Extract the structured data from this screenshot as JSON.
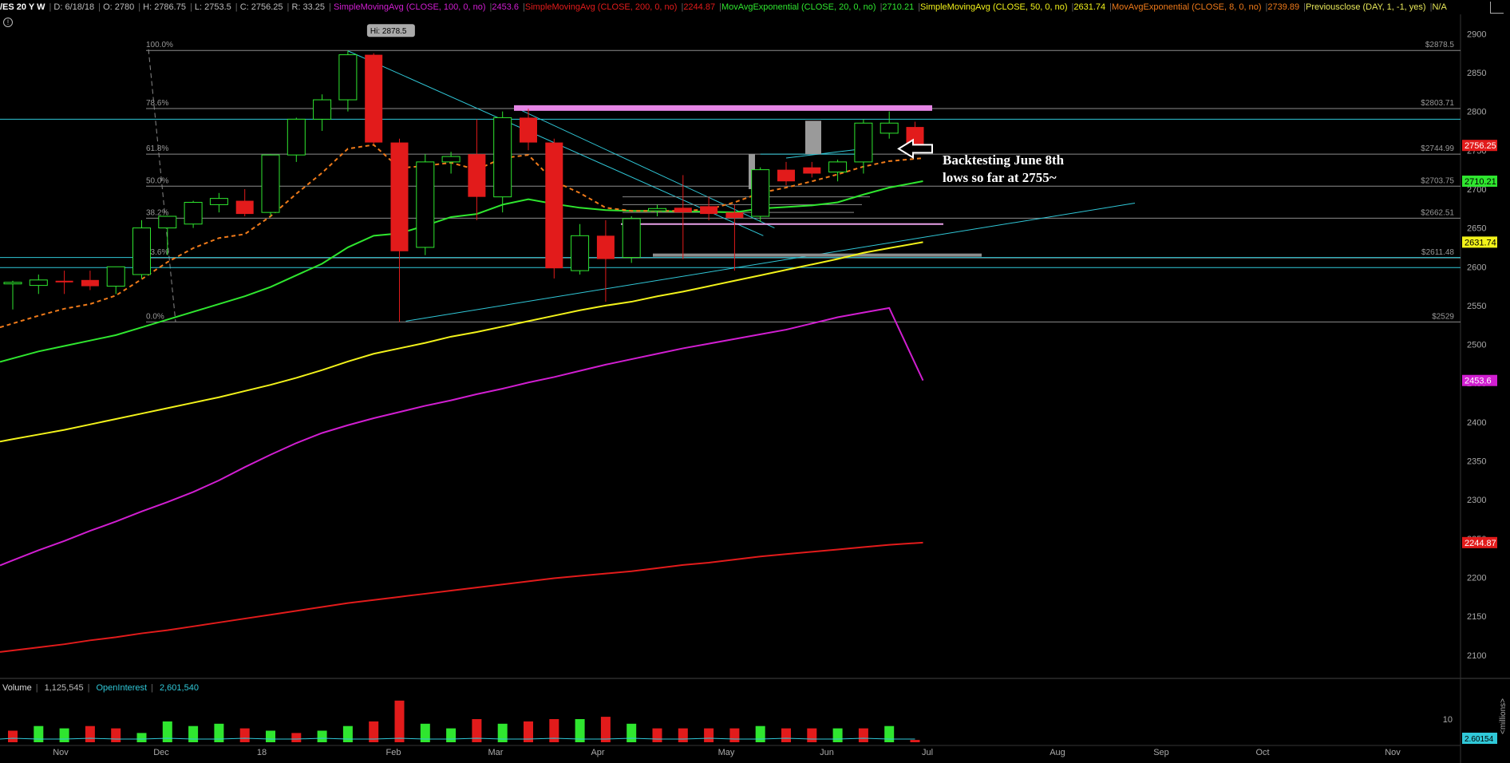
{
  "header": {
    "symbol": "/ES 20 Y W",
    "date": "D: 6/18/18",
    "open": "O: 2780",
    "high": "H: 2786.75",
    "low": "L: 2753.5",
    "close": "C: 2756.25",
    "range": "R: 33.25",
    "studies": [
      {
        "label": "SimpleMovingAvg (CLOSE, 100, 0, no)",
        "value": "2453.6",
        "color": "#d11ed1"
      },
      {
        "label": "SimpleMovingAvg (CLOSE, 200, 0, no)",
        "value": "2244.87",
        "color": "#e21b1b"
      },
      {
        "label": "MovAvgExponential (CLOSE, 20, 0, no)",
        "value": "2710.21",
        "color": "#2fe62f"
      },
      {
        "label": "SimpleMovingAvg (CLOSE, 50, 0, no)",
        "value": "2631.74",
        "color": "#f2f21a"
      },
      {
        "label": "MovAvgExponential (CLOSE, 8, 0, no)",
        "value": "2739.89",
        "color": "#ef7a1a"
      },
      {
        "label": "Previousclose (DAY, 1, -1, yes)",
        "value": "N/A",
        "color": "#e8e85a"
      }
    ]
  },
  "alert_icon": "info-circle-icon",
  "annotation": {
    "line1": "Backtesting June 8th",
    "line2": "lows so far at 2755~",
    "arrow_icon": "left-arrow-icon"
  },
  "volume_panel": {
    "label": "Volume",
    "value": "1,125,545",
    "oi_label": "OpenInterest",
    "oi_value": "2,601,540",
    "axis_tick": "10",
    "axis_unit": "<millions>",
    "oi_tag": "2.60154"
  },
  "chart_data": {
    "type": "candlestick",
    "title": "",
    "ylim": [
      2070,
      2925
    ],
    "y_ticks": [
      2100,
      2150,
      2200,
      2250,
      2300,
      2350,
      2400,
      2450,
      2500,
      2550,
      2600,
      2650,
      2700,
      2750,
      2800,
      2850,
      2900
    ],
    "x_labels": [
      "Nov",
      "Dec",
      "18",
      "Feb",
      "Mar",
      "Apr",
      "May",
      "Jun",
      "Jul",
      "Aug",
      "Sep",
      "Oct",
      "Nov"
    ],
    "candles": [
      {
        "o": 2578,
        "h": 2582,
        "l": 2545,
        "c": 2580
      },
      {
        "o": 2576,
        "h": 2590,
        "l": 2565,
        "c": 2583
      },
      {
        "o": 2582,
        "h": 2595,
        "l": 2565,
        "c": 2580
      },
      {
        "o": 2583,
        "h": 2595,
        "l": 2570,
        "c": 2575
      },
      {
        "o": 2575,
        "h": 2600,
        "l": 2565,
        "c": 2600
      },
      {
        "o": 2590,
        "h": 2660,
        "l": 2585,
        "c": 2650
      },
      {
        "o": 2650,
        "h": 2665,
        "l": 2615,
        "c": 2665
      },
      {
        "o": 2655,
        "h": 2685,
        "l": 2650,
        "c": 2683
      },
      {
        "o": 2680,
        "h": 2695,
        "l": 2670,
        "c": 2688
      },
      {
        "o": 2685,
        "h": 2700,
        "l": 2665,
        "c": 2668
      },
      {
        "o": 2670,
        "h": 2745,
        "l": 2665,
        "c": 2744
      },
      {
        "o": 2744,
        "h": 2792,
        "l": 2735,
        "c": 2790
      },
      {
        "o": 2790,
        "h": 2822,
        "l": 2775,
        "c": 2815
      },
      {
        "o": 2815,
        "h": 2878.5,
        "l": 2800,
        "c": 2873
      },
      {
        "o": 2873,
        "h": 2875,
        "l": 2758,
        "c": 2760
      },
      {
        "o": 2760,
        "h": 2765,
        "l": 2529,
        "c": 2620
      },
      {
        "o": 2625,
        "h": 2745,
        "l": 2615,
        "c": 2735
      },
      {
        "o": 2735,
        "h": 2748,
        "l": 2720,
        "c": 2742
      },
      {
        "o": 2745,
        "h": 2790,
        "l": 2660,
        "c": 2690
      },
      {
        "o": 2690,
        "h": 2800,
        "l": 2670,
        "c": 2792
      },
      {
        "o": 2792,
        "h": 2803.5,
        "l": 2750,
        "c": 2760
      },
      {
        "o": 2760,
        "h": 2765,
        "l": 2585,
        "c": 2598
      },
      {
        "o": 2595,
        "h": 2655,
        "l": 2590,
        "c": 2640
      },
      {
        "o": 2640,
        "h": 2660,
        "l": 2555,
        "c": 2610
      },
      {
        "o": 2612,
        "h": 2665,
        "l": 2605,
        "c": 2662
      },
      {
        "o": 2672,
        "h": 2680,
        "l": 2665,
        "c": 2675
      },
      {
        "o": 2676,
        "h": 2718,
        "l": 2610,
        "c": 2670
      },
      {
        "o": 2678,
        "h": 2690,
        "l": 2660,
        "c": 2668
      },
      {
        "o": 2670,
        "h": 2680,
        "l": 2595,
        "c": 2663
      },
      {
        "o": 2665,
        "h": 2728,
        "l": 2658,
        "c": 2725
      },
      {
        "o": 2725,
        "h": 2735,
        "l": 2705,
        "c": 2710
      },
      {
        "o": 2728,
        "h": 2735,
        "l": 2715,
        "c": 2720
      },
      {
        "o": 2722,
        "h": 2738,
        "l": 2710,
        "c": 2735
      },
      {
        "o": 2735,
        "h": 2790,
        "l": 2720,
        "c": 2785
      },
      {
        "o": 2772,
        "h": 2800,
        "l": 2765,
        "c": 2785
      },
      {
        "o": 2780,
        "h": 2786.75,
        "l": 2753.5,
        "c": 2756.25
      }
    ],
    "volume": [
      {
        "v": 5,
        "up": false
      },
      {
        "v": 7,
        "up": true
      },
      {
        "v": 6,
        "up": true
      },
      {
        "v": 7,
        "up": false
      },
      {
        "v": 6,
        "up": false
      },
      {
        "v": 4,
        "up": true
      },
      {
        "v": 9,
        "up": true
      },
      {
        "v": 7,
        "up": true
      },
      {
        "v": 8,
        "up": true
      },
      {
        "v": 6,
        "up": false
      },
      {
        "v": 5,
        "up": true
      },
      {
        "v": 4,
        "up": false
      },
      {
        "v": 5,
        "up": true
      },
      {
        "v": 7,
        "up": true
      },
      {
        "v": 9,
        "up": false
      },
      {
        "v": 18,
        "up": false
      },
      {
        "v": 8,
        "up": true
      },
      {
        "v": 6,
        "up": true
      },
      {
        "v": 10,
        "up": false
      },
      {
        "v": 8,
        "up": true
      },
      {
        "v": 9,
        "up": false
      },
      {
        "v": 10,
        "up": false
      },
      {
        "v": 10,
        "up": true
      },
      {
        "v": 11,
        "up": false
      },
      {
        "v": 8,
        "up": true
      },
      {
        "v": 6,
        "up": false
      },
      {
        "v": 6,
        "up": false
      },
      {
        "v": 6,
        "up": false
      },
      {
        "v": 6,
        "up": false
      },
      {
        "v": 7,
        "up": true
      },
      {
        "v": 6,
        "up": false
      },
      {
        "v": 6,
        "up": false
      },
      {
        "v": 6,
        "up": true
      },
      {
        "v": 6,
        "up": false
      },
      {
        "v": 7,
        "up": true
      },
      {
        "v": 1,
        "up": false
      }
    ],
    "moving_averages": [
      {
        "name": "SimpleMovingAvg (CLOSE, 100, 0, no)",
        "color": "#d11ed1",
        "style": "solid",
        "values": [
          2222,
          2235,
          2247,
          2260,
          2272,
          2285,
          2297,
          2310,
          2325,
          2342,
          2358,
          2373,
          2386,
          2396,
          2405,
          2413,
          2421,
          2428,
          2436,
          2443,
          2451,
          2458,
          2466,
          2474,
          2481,
          2488,
          2495,
          2501,
          2507,
          2513,
          2519,
          2527,
          2535,
          2541,
          2547,
          2453.6
        ]
      },
      {
        "name": "SimpleMovingAvg (CLOSE, 200, 0, no)",
        "color": "#e21b1b",
        "style": "solid",
        "values": [
          2106,
          2110,
          2114,
          2119,
          2123,
          2128,
          2132,
          2137,
          2142,
          2147,
          2152,
          2157,
          2162,
          2167,
          2171,
          2175,
          2179,
          2183,
          2187,
          2191,
          2195,
          2199,
          2202,
          2205,
          2208,
          2212,
          2216,
          2219,
          2223,
          2227,
          2230,
          2233,
          2236,
          2239,
          2242,
          2244.87
        ]
      },
      {
        "name": "MovAvgExponential (CLOSE, 20, 0, no)",
        "color": "#2fe62f",
        "style": "solid",
        "values": [
          2482,
          2491,
          2498,
          2505,
          2512,
          2522,
          2532,
          2542,
          2552,
          2562,
          2574,
          2589,
          2604,
          2625,
          2640,
          2643,
          2653,
          2664,
          2668,
          2680,
          2687,
          2681,
          2676,
          2673,
          2672,
          2672,
          2671,
          2671,
          2670,
          2675,
          2677,
          2679,
          2683,
          2693,
          2702,
          2710.21
        ]
      },
      {
        "name": "SimpleMovingAvg (CLOSE, 50, 0, no)",
        "color": "#f2f21a",
        "style": "solid",
        "values": [
          2378,
          2384,
          2390,
          2397,
          2404,
          2411,
          2418,
          2425,
          2432,
          2440,
          2448,
          2457,
          2467,
          2478,
          2488,
          2495,
          2502,
          2510,
          2516,
          2523,
          2530,
          2537,
          2544,
          2550,
          2555,
          2562,
          2568,
          2575,
          2582,
          2589,
          2596,
          2603,
          2610,
          2618,
          2624,
          2631.74
        ]
      },
      {
        "name": "MovAvgExponential (CLOSE, 8, 0, no)",
        "color": "#ef7a1a",
        "style": "dashed",
        "values": [
          2527,
          2537,
          2546,
          2552,
          2563,
          2584,
          2606,
          2624,
          2637,
          2642,
          2665,
          2694,
          2721,
          2752,
          2757,
          2727,
          2730,
          2734,
          2725,
          2740,
          2744,
          2710,
          2695,
          2676,
          2672,
          2672,
          2672,
          2674,
          2683,
          2695,
          2702,
          2710,
          2719,
          2729,
          2736,
          2739.89
        ]
      }
    ],
    "fibonacci": [
      {
        "label": "100.0%",
        "price": 2878.5,
        "price_label": "$2878.5"
      },
      {
        "label": "78.6%",
        "price": 2803.71,
        "price_label": "$2803.71"
      },
      {
        "label": "61.8%",
        "price": 2744.99,
        "price_label": "$2744.99"
      },
      {
        "label": "50.0%",
        "price": 2703.75,
        "price_label": "$2703.75"
      },
      {
        "label": "38.2%",
        "price": 2662.51,
        "price_label": "$2662.51"
      },
      {
        "label": "23.6%",
        "price": 2611.48,
        "price_label": "$2611.48"
      },
      {
        "label": "0.0%",
        "price": 2529,
        "price_label": "$2529"
      }
    ],
    "hi_label": "Hi: 2878.5",
    "price_tags": [
      {
        "value": "2756.25",
        "price": 2756.25,
        "bg": "#e21b1b",
        "fg": "#ffffff"
      },
      {
        "value": "2710.21",
        "price": 2710.21,
        "bg": "#2fe62f",
        "fg": "#000000"
      },
      {
        "value": "2631.74",
        "price": 2631.74,
        "bg": "#f2f21a",
        "fg": "#000000"
      },
      {
        "value": "2453.6",
        "price": 2453.6,
        "bg": "#d11ed1",
        "fg": "#ffffff"
      },
      {
        "value": "2244.87",
        "price": 2244.87,
        "bg": "#e21b1b",
        "fg": "#ffffff"
      }
    ],
    "colors": {
      "up": "#2fe62f",
      "down": "#e21b1b",
      "grid": "#333333",
      "fib": "#8c8c8c",
      "trend": "#30c8d8"
    }
  }
}
